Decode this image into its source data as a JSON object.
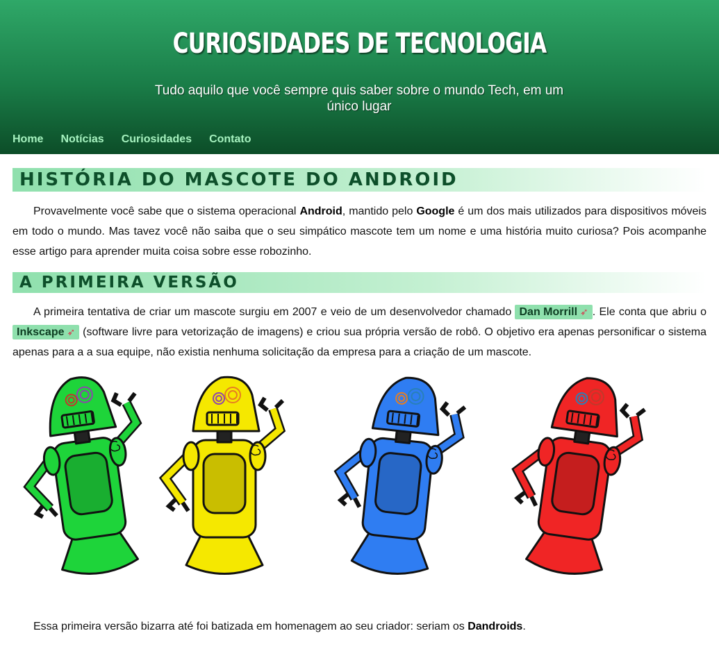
{
  "site": {
    "title": "CURIOSIDADES DE TECNOLOGIA",
    "subtitle": "Tudo aquilo que você sempre quis saber sobre o mundo Tech, em um único lugar"
  },
  "nav": {
    "items": [
      {
        "label": "Home"
      },
      {
        "label": "Notícias"
      },
      {
        "label": "Curiosidades"
      },
      {
        "label": "Contato"
      }
    ]
  },
  "article": {
    "heading1": "História do mascote do Android",
    "intro": {
      "t1": "Provavelmente você sabe que o sistema operacional ",
      "b1": "Android",
      "t2": ", mantido pelo ",
      "b2": "Google",
      "t3": " é um dos mais utilizados para dispositivos móveis em todo o mundo. Mas tavez você não saiba que o seu simpático mascote tem um nome e uma história muito curiosa? Pois acompanhe esse artigo para aprender muita coisa sobre esse robozinho."
    },
    "heading2": "A primeira versão",
    "first_version": {
      "t1": "A primeira tentativa de criar um mascote surgiu em 2007 e veio de um desenvolvedor chamado ",
      "link1": "Dan Morrill",
      "t2": ". Ele conta que abriu o ",
      "link2": "Inkscape",
      "t3": " (software livre para vetorização de imagens) e criou sua própria versão de robô. O objetivo era apenas personificar o sistema apenas para a a sua equipe, não existia nenhuma solicitação da empresa para a criação de um mascote."
    },
    "closing": {
      "t1": "Essa primeira versão bizarra até foi batizada em homenagem ao seu criador: seriam os ",
      "b1": "Dandroids",
      "t2": "."
    },
    "link_icon": "rocket-icon"
  },
  "colors": {
    "header_top": "#2fa868",
    "header_bottom": "#0c4d28",
    "nav_link": "#a6f2bf",
    "heading_bg": "#8fe0ad",
    "heading_text": "#0d4f2a",
    "robot_colors": [
      "#1ed43a",
      "#f5e800",
      "#2f7df2",
      "#f02525"
    ]
  }
}
